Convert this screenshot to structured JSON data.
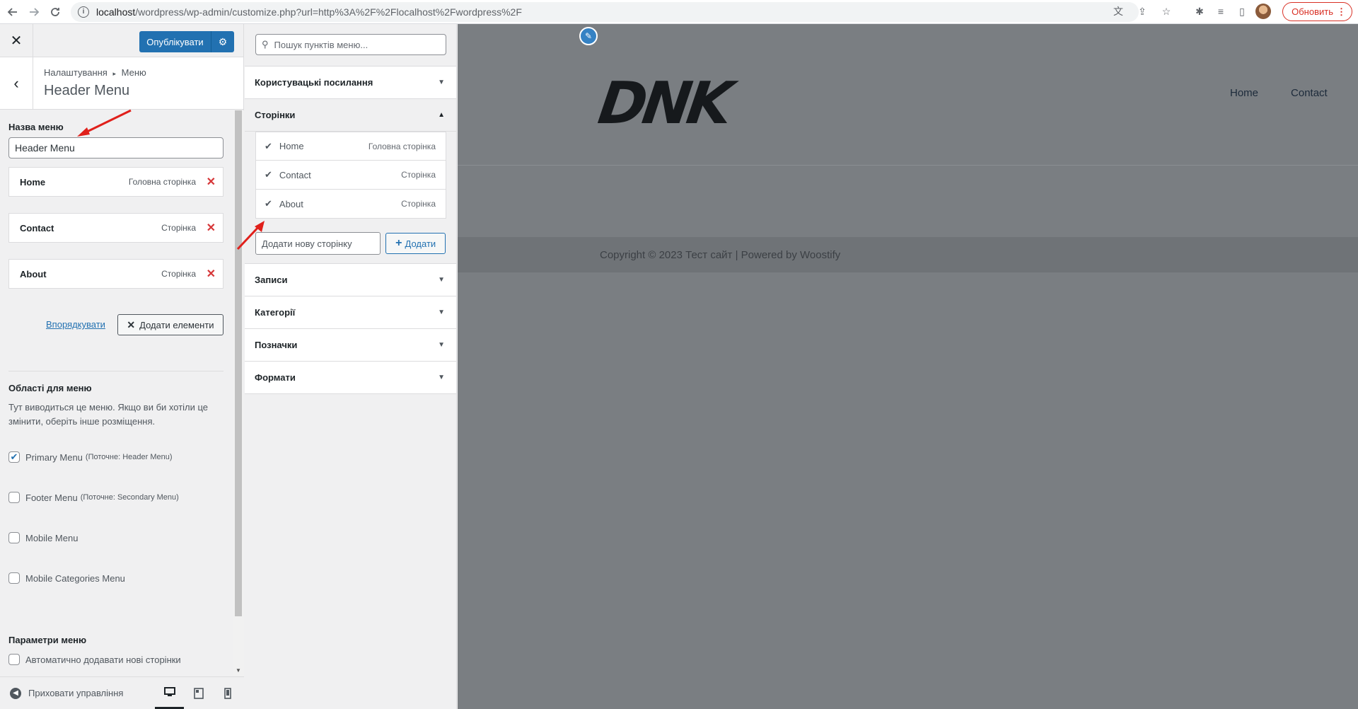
{
  "browser": {
    "url_host": "localhost",
    "url_rest": "/wordpress/wp-admin/customize.php?url=http%3A%2F%2Flocalhost%2Fwordpress%2F",
    "update_label": "Обновить"
  },
  "customizer": {
    "publish_label": "Опублікувати",
    "breadcrumb_root": "Налаштування",
    "breadcrumb_sep": "▸",
    "breadcrumb_section": "Меню",
    "section_title": "Header Menu",
    "menu_name_label": "Назва меню",
    "menu_name_value": "Header Menu",
    "items": [
      {
        "title": "Home",
        "type": "Головна сторінка"
      },
      {
        "title": "Contact",
        "type": "Сторінка"
      },
      {
        "title": "About",
        "type": "Сторінка"
      }
    ],
    "reorder_label": "Впорядкувати",
    "add_items_label": "Додати елементи",
    "locations_title": "Області для меню",
    "locations_desc": "Тут виводиться це меню. Якщо ви би хотіли це змінити, оберіть інше розміщення.",
    "locations": [
      {
        "label": "Primary Menu",
        "sub": "(Поточне: Header Menu)",
        "checked": true
      },
      {
        "label": "Footer Menu",
        "sub": "(Поточне: Secondary Menu)",
        "checked": false
      },
      {
        "label": "Mobile Menu",
        "sub": "",
        "checked": false
      },
      {
        "label": "Mobile Categories Menu",
        "sub": "",
        "checked": false
      }
    ],
    "params_title": "Параметри меню",
    "auto_add_label": "Автоматично додавати нові сторінки",
    "hide_controls_label": "Приховати управління"
  },
  "add_panel": {
    "search_placeholder": "Пошук пунктів меню...",
    "custom_links": "Користувацькі посилання",
    "pages": "Сторінки",
    "page_items": [
      {
        "title": "Home",
        "type": "Головна сторінка"
      },
      {
        "title": "Contact",
        "type": "Сторінка"
      },
      {
        "title": "About",
        "type": "Сторінка"
      }
    ],
    "new_page_placeholder": "Додати нову сторінку",
    "add_label": "Додати",
    "posts": "Записи",
    "categories": "Категорії",
    "tags": "Позначки",
    "formats": "Формати"
  },
  "preview": {
    "logo_text": "DNK",
    "nav": [
      "Home",
      "Contact"
    ],
    "copyright": "Copyright © 2023 Тест сайт | Powered by Woostify"
  },
  "colors": {
    "accent": "#2271b1",
    "remove": "#d63638",
    "annotation": "#e0201b"
  }
}
